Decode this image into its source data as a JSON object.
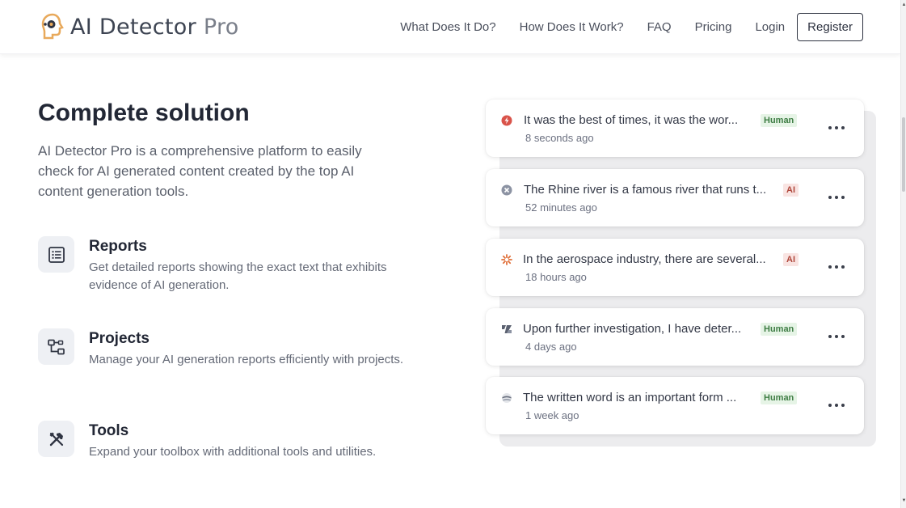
{
  "brand": {
    "name": "AI Detector",
    "suffix": "Pro"
  },
  "nav": {
    "links": [
      "What Does It Do?",
      "How Does It Work?",
      "FAQ",
      "Pricing",
      "Login"
    ],
    "register_label": "Register"
  },
  "hero": {
    "title": "Complete solution",
    "intro": "AI Detector Pro is a comprehensive platform to easily check for AI generated content created by the top AI content generation tools."
  },
  "features": [
    {
      "title": "Reports",
      "description": "Get detailed reports showing the exact text that exhibits evidence of AI generation.",
      "icon": "report-list-icon"
    },
    {
      "title": "Projects",
      "description": "Manage your AI generation reports efficiently with projects.",
      "icon": "projects-flow-icon"
    },
    {
      "title": "Tools",
      "description": "Expand your toolbox with additional tools and utilities.",
      "icon": "tools-icon"
    }
  ],
  "reports": [
    {
      "text": "It was the best of times, it was the wor...",
      "time": "8 seconds ago",
      "label": "Human",
      "type": "human",
      "icon": "red-bolt-icon"
    },
    {
      "text": "The Rhine river is a famous river that runs t...",
      "time": "52 minutes ago",
      "label": "AI",
      "type": "ai",
      "icon": "gray-circle-icon"
    },
    {
      "text": "In the aerospace industry, there are several...",
      "time": "18 hours ago",
      "label": "AI",
      "type": "ai",
      "icon": "orange-burst-icon"
    },
    {
      "text": "Upon further investigation, I have deter...",
      "time": "4 days ago",
      "label": "Human",
      "type": "human",
      "icon": "slanted-logo-icon"
    },
    {
      "text": "The written word is an important form ...",
      "time": "1 week ago",
      "label": "Human",
      "type": "human",
      "icon": "layered-disc-icon"
    }
  ],
  "colors": {
    "human_badge_bg": "#e6f4e6",
    "human_badge_text": "#3e7d44",
    "ai_badge_bg": "#f9e4e2",
    "ai_badge_text": "#b0483c"
  }
}
